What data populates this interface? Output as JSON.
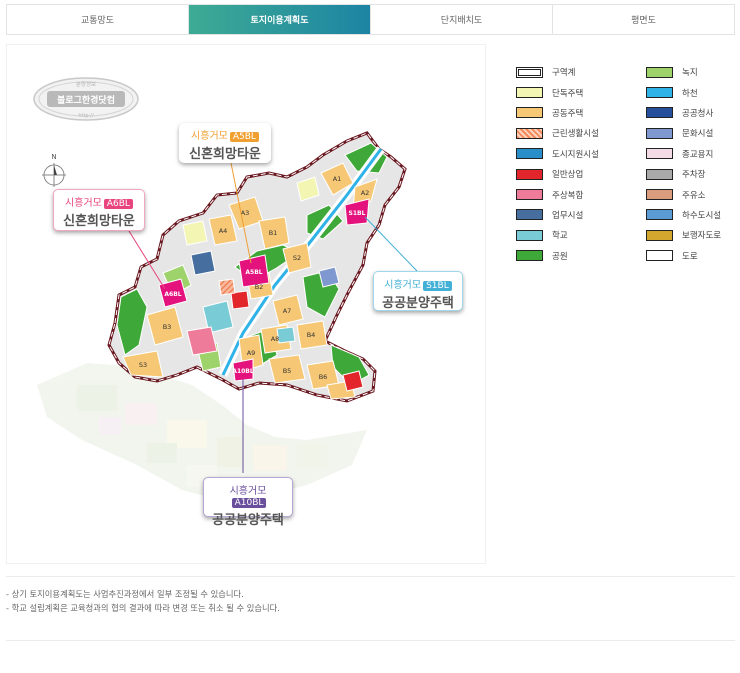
{
  "tabs": [
    {
      "label": "교통망도",
      "active": false
    },
    {
      "label": "토지이용계획도",
      "active": true
    },
    {
      "label": "단지배치도",
      "active": false
    },
    {
      "label": "평면도",
      "active": false
    }
  ],
  "stamp": {
    "main": "블로그한경닷컴",
    "top": "분양정보",
    "bottom": "http://"
  },
  "compass": {
    "label": "N"
  },
  "callouts": {
    "a5": {
      "prefix": "시흥거모",
      "badge": "A5BL",
      "name": "신혼희망타운",
      "color": "#f0a031"
    },
    "a6": {
      "prefix": "시흥거모",
      "badge": "A6BL",
      "name": "신혼희망타운",
      "color": "#e8457e"
    },
    "s1": {
      "prefix": "시흥거모",
      "badge": "S1BL",
      "name": "공공분양주택",
      "color": "#43b0d6"
    },
    "a10": {
      "prefix": "시흥거모",
      "badge": "A10BL",
      "name": "공공분양주택",
      "color": "#6a4f9c"
    }
  },
  "map_labels": {
    "a1": "A1",
    "a2": "A2",
    "a3": "A3",
    "a4": "A4",
    "a5": "A5BL",
    "a6": "A6BL",
    "a7": "A7",
    "a8": "A8",
    "a9": "A9",
    "a10": "A10BL",
    "b1": "B1",
    "b2": "B2",
    "b3": "B3",
    "b4": "B4",
    "b5": "B5",
    "b6": "B6",
    "s1": "S1BL",
    "s2": "S2",
    "s3": "S3"
  },
  "legend": [
    {
      "label": "구역계",
      "color": "#ffffff",
      "icon": "boundary-swatch"
    },
    {
      "label": "단독주택",
      "color": "#f3f5b3",
      "icon": "swatch"
    },
    {
      "label": "공동주택",
      "color": "#f6c774",
      "icon": "swatch"
    },
    {
      "label": "근린생활시설",
      "color": "#f48a5c",
      "icon": "hatched-swatch"
    },
    {
      "label": "도시지원시설",
      "color": "#2a8fc9",
      "icon": "swatch"
    },
    {
      "label": "일반상업",
      "color": "#e2262c",
      "icon": "swatch"
    },
    {
      "label": "주상복합",
      "color": "#ef7b9a",
      "icon": "swatch"
    },
    {
      "label": "업무시설",
      "color": "#466fa0",
      "icon": "swatch"
    },
    {
      "label": "학교",
      "color": "#79cbd6",
      "icon": "swatch"
    },
    {
      "label": "공원",
      "color": "#3ea838",
      "icon": "swatch"
    },
    {
      "label": "녹지",
      "color": "#9ed26a",
      "icon": "swatch"
    },
    {
      "label": "하천",
      "color": "#2fb2e7",
      "icon": "swatch"
    },
    {
      "label": "공공청사",
      "color": "#264f9b",
      "icon": "swatch"
    },
    {
      "label": "문화시설",
      "color": "#7f98cf",
      "icon": "swatch"
    },
    {
      "label": "종교용지",
      "color": "#f3dbe6",
      "icon": "swatch"
    },
    {
      "label": "주차장",
      "color": "#a9a9a9",
      "icon": "swatch"
    },
    {
      "label": "주유소",
      "color": "#d99c7c",
      "icon": "swatch"
    },
    {
      "label": "하수도시설",
      "color": "#5b9bd3",
      "icon": "swatch"
    },
    {
      "label": "보행자도로",
      "color": "#d3a62e",
      "icon": "swatch"
    },
    {
      "label": "도로",
      "color": "#ffffff",
      "icon": "swatch"
    }
  ],
  "notes": [
    "- 상기 토지이용계획도는 사업추진과정에서 일부 조정될 수 있습니다.",
    "- 학교 설립계획은 교육청과의 협의 결과에 따라 변경 또는 취소 될 수 있습니다."
  ]
}
